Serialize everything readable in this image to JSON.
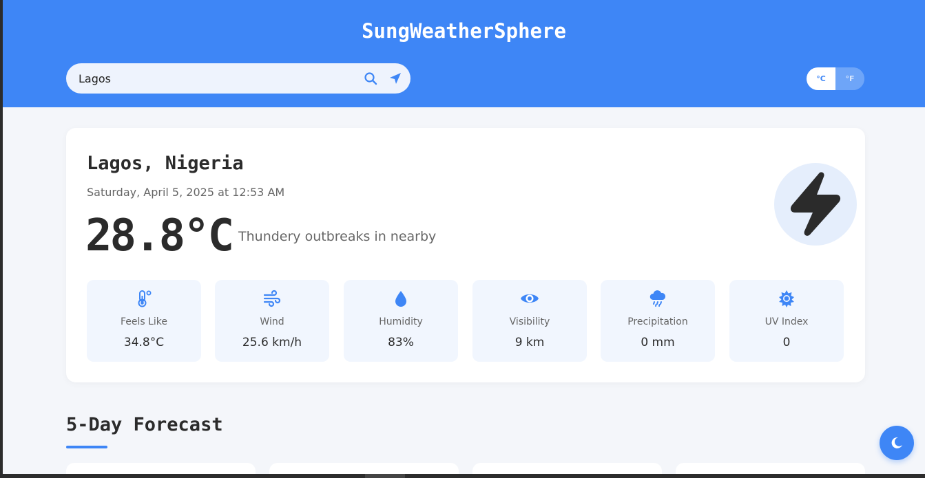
{
  "app": {
    "title": "SungWeatherSphere"
  },
  "search": {
    "value": "Lagos",
    "search_icon": "search-icon",
    "locate_icon": "location-arrow-icon"
  },
  "units": {
    "celsius": "°C",
    "fahrenheit": "°F",
    "selected": "°C"
  },
  "current": {
    "location": "Lagos, Nigeria",
    "datetime": "Saturday, April 5, 2025 at 12:53 AM",
    "temperature": "28.8°C",
    "condition": "Thundery outbreaks in nearby",
    "icon": "lightning-bolt-icon"
  },
  "stats": [
    {
      "icon": "thermometer-icon",
      "label": "Feels Like",
      "value": "34.8°C"
    },
    {
      "icon": "wind-icon",
      "label": "Wind",
      "value": "25.6 km/h"
    },
    {
      "icon": "droplet-icon",
      "label": "Humidity",
      "value": "83%"
    },
    {
      "icon": "eye-icon",
      "label": "Visibility",
      "value": "9 km"
    },
    {
      "icon": "cloud-rain-icon",
      "label": "Precipitation",
      "value": "0 mm"
    },
    {
      "icon": "sun-icon",
      "label": "UV Index",
      "value": "0"
    }
  ],
  "forecast": {
    "title": "5-Day Forecast"
  },
  "theme_toggle": {
    "icon": "moon-icon"
  },
  "colors": {
    "accent": "#3e86f6",
    "background": "#f4f6fa",
    "card": "#ffffff",
    "stat_bg": "#f1f6fe"
  }
}
